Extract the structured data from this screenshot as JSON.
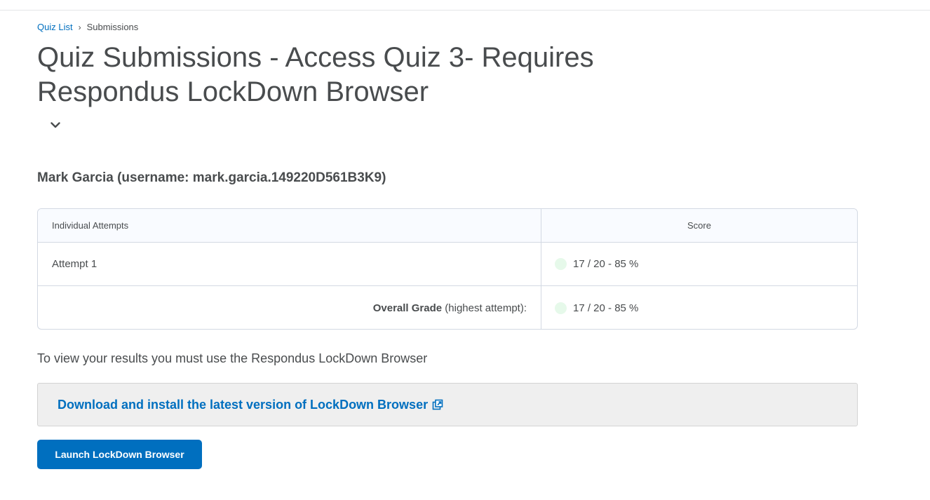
{
  "breadcrumb": {
    "link_label": "Quiz List",
    "separator": "›",
    "current": "Submissions"
  },
  "page": {
    "title": "Quiz Submissions - Access Quiz 3- Requires Respondus LockDown Browser"
  },
  "user": {
    "heading": "Mark Garcia (username: mark.garcia.149220D561B3K9)"
  },
  "table": {
    "col_attempts": "Individual Attempts",
    "col_score": "Score",
    "rows": [
      {
        "label": "Attempt 1",
        "score": "17 / 20 - 85 %"
      }
    ],
    "overall": {
      "label_bold": "Overall Grade",
      "label_note": " (highest attempt):",
      "score": "17 / 20 - 85 %"
    }
  },
  "info": {
    "text": "To view your results you must use the Respondus LockDown Browser"
  },
  "download": {
    "link_label": "Download and install the latest version of LockDown Browser"
  },
  "launch": {
    "button_label": "Launch LockDown Browser"
  },
  "colors": {
    "link": "#006fbf",
    "score_indicator": "#e6f9ea",
    "text": "#494c4e"
  },
  "icons": {
    "title_toggle": "chevron-down-icon",
    "external_link": "external-link-icon"
  }
}
